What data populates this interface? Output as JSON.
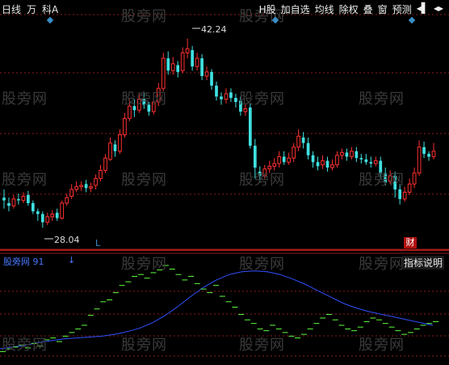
{
  "header": {
    "tabs": [
      {
        "label": "日线"
      },
      {
        "label": "万"
      },
      {
        "label": "科A"
      }
    ]
  },
  "toolbar": {
    "items": [
      {
        "label": "H股"
      },
      {
        "label": "加自选"
      },
      {
        "label": "均线"
      },
      {
        "label": "除权"
      },
      {
        "label": "叠"
      },
      {
        "label": "窗"
      },
      {
        "label": "预测"
      },
      {
        "label": "◂▌"
      },
      {
        "label": "◂▸"
      }
    ]
  },
  "watermark": "股旁网",
  "price_labels": {
    "high": "42.24",
    "low": "28.04"
  },
  "markers": {
    "cai": "财",
    "l_mark": "L",
    "arrow": "↓"
  },
  "indicator": {
    "name": "股旁网  91",
    "explain_button": "指标说明"
  },
  "colors": {
    "background": "#000000",
    "up_candle": "#ff3030",
    "down_candle": "#40e0e0",
    "grid": "#8b1a1a",
    "indicator_line": "#3050ff",
    "indicator_dash": "#60ff40"
  },
  "chart_data": {
    "type": "candlestick",
    "ylim": [
      27,
      44
    ],
    "candles": [
      [
        30.6,
        30.4,
        31.2,
        29.8
      ],
      [
        30.2,
        30.0,
        30.6,
        29.6
      ],
      [
        30.0,
        30.5,
        30.8,
        29.8
      ],
      [
        30.5,
        30.4,
        30.9,
        30.1
      ],
      [
        30.4,
        30.7,
        31.0,
        30.2
      ],
      [
        30.8,
        30.2,
        31.1,
        30.0
      ],
      [
        30.2,
        29.6,
        30.4,
        29.4
      ],
      [
        29.6,
        29.4,
        29.8,
        28.9
      ],
      [
        29.4,
        28.8,
        29.6,
        28.4
      ],
      [
        28.8,
        29.2,
        29.5,
        28.6
      ],
      [
        29.2,
        29.4,
        29.7,
        28.9
      ],
      [
        29.5,
        29.1,
        29.8,
        28.9
      ],
      [
        29.1,
        30.2,
        30.4,
        29.0
      ],
      [
        30.2,
        30.6,
        30.9,
        30.0
      ],
      [
        30.7,
        31.2,
        31.6,
        30.5
      ],
      [
        31.2,
        31.4,
        31.8,
        31.0
      ],
      [
        31.4,
        31.5,
        31.8,
        31.1
      ],
      [
        31.6,
        31.3,
        31.9,
        31.0
      ],
      [
        31.3,
        31.4,
        31.7,
        31.0
      ],
      [
        31.5,
        32.0,
        32.3,
        31.2
      ],
      [
        32.0,
        32.6,
        33.0,
        31.8
      ],
      [
        32.6,
        33.5,
        33.8,
        32.4
      ],
      [
        33.4,
        34.6,
        35.0,
        33.3
      ],
      [
        34.5,
        34.0,
        34.8,
        33.6
      ],
      [
        34.0,
        35.2,
        35.6,
        33.8
      ],
      [
        35.2,
        36.4,
        36.8,
        35.0
      ],
      [
        36.4,
        37.3,
        37.8,
        36.2
      ],
      [
        37.3,
        37.0,
        37.8,
        36.5
      ],
      [
        37.0,
        37.8,
        38.2,
        36.8
      ],
      [
        37.8,
        37.4,
        38.3,
        37.1
      ],
      [
        37.4,
        36.9,
        37.6,
        36.6
      ],
      [
        36.9,
        37.6,
        38.0,
        36.7
      ],
      [
        37.6,
        38.6,
        39.0,
        37.3
      ],
      [
        38.6,
        40.8,
        41.2,
        38.4
      ],
      [
        40.8,
        39.9,
        41.3,
        39.6
      ],
      [
        39.9,
        40.4,
        40.9,
        39.6
      ],
      [
        40.3,
        39.8,
        40.6,
        39.4
      ],
      [
        39.9,
        41.2,
        41.6,
        39.7
      ],
      [
        41.2,
        41.5,
        42.24,
        40.8
      ],
      [
        41.4,
        40.2,
        41.7,
        39.9
      ],
      [
        40.2,
        40.8,
        41.2,
        39.9
      ],
      [
        40.8,
        39.5,
        41.1,
        39.2
      ],
      [
        39.5,
        39.8,
        40.2,
        39.2
      ],
      [
        39.8,
        38.8,
        40.0,
        38.5
      ],
      [
        38.8,
        38.0,
        39.1,
        37.7
      ],
      [
        38.0,
        37.8,
        38.3,
        37.4
      ],
      [
        37.8,
        38.2,
        38.6,
        37.5
      ],
      [
        38.3,
        37.9,
        38.6,
        37.6
      ],
      [
        37.9,
        37.6,
        38.2,
        37.2
      ],
      [
        37.7,
        36.9,
        38.0,
        36.6
      ],
      [
        36.9,
        37.1,
        37.5,
        36.6
      ],
      [
        37.2,
        34.4,
        37.5,
        34.2
      ],
      [
        34.4,
        32.8,
        34.9,
        32.0
      ],
      [
        32.5,
        32.2,
        32.9,
        31.7
      ],
      [
        32.2,
        32.7,
        33.0,
        32.0
      ],
      [
        32.7,
        32.9,
        33.3,
        32.4
      ],
      [
        32.9,
        33.1,
        33.5,
        32.6
      ],
      [
        33.1,
        33.6,
        34.0,
        32.8
      ],
      [
        33.6,
        33.2,
        34.0,
        33.0
      ],
      [
        33.2,
        33.5,
        33.9,
        33.0
      ],
      [
        33.5,
        34.3,
        34.6,
        33.2
      ],
      [
        34.3,
        35.1,
        35.6,
        34.0
      ],
      [
        35.0,
        34.6,
        35.4,
        34.2
      ],
      [
        34.6,
        33.7,
        35.0,
        33.4
      ],
      [
        33.7,
        33.2,
        34.0,
        32.8
      ],
      [
        33.2,
        32.9,
        33.6,
        32.6
      ],
      [
        33.0,
        33.3,
        33.7,
        32.7
      ],
      [
        33.3,
        32.8,
        33.6,
        32.5
      ],
      [
        32.8,
        33.0,
        33.4,
        32.6
      ],
      [
        33.0,
        33.7,
        34.0,
        32.8
      ],
      [
        33.7,
        33.9,
        34.2,
        33.4
      ],
      [
        33.9,
        33.6,
        34.2,
        33.3
      ],
      [
        33.6,
        34.0,
        34.3,
        33.4
      ],
      [
        34.0,
        33.5,
        34.3,
        33.2
      ],
      [
        33.5,
        33.4,
        33.8,
        33.1
      ],
      [
        33.4,
        33.2,
        33.8,
        33.0
      ],
      [
        33.2,
        33.1,
        33.6,
        32.8
      ],
      [
        33.1,
        33.3,
        33.6,
        32.9
      ],
      [
        33.3,
        32.4,
        33.6,
        32.0
      ],
      [
        32.4,
        31.7,
        32.8,
        31.5
      ],
      [
        31.8,
        32.2,
        32.6,
        31.6
      ],
      [
        32.2,
        31.2,
        32.5,
        30.6
      ],
      [
        31.2,
        30.5,
        31.6,
        30.1
      ],
      [
        30.5,
        31.0,
        31.4,
        30.3
      ],
      [
        31.0,
        31.6,
        32.0,
        30.8
      ],
      [
        31.6,
        32.4,
        32.8,
        31.3
      ],
      [
        32.4,
        34.3,
        34.8,
        32.2
      ],
      [
        34.3,
        33.8,
        34.7,
        33.5
      ],
      [
        33.8,
        33.6,
        34.0,
        33.3
      ],
      [
        33.6,
        34.0,
        34.6,
        33.4
      ]
    ]
  },
  "indicator_data": {
    "line": [
      0.08,
      0.1,
      0.12,
      0.15,
      0.17,
      0.19,
      0.2,
      0.21,
      0.22,
      0.24,
      0.27,
      0.31,
      0.37,
      0.45,
      0.55,
      0.66,
      0.76,
      0.84,
      0.9,
      0.93,
      0.94,
      0.93,
      0.9,
      0.85,
      0.79,
      0.72,
      0.65,
      0.58,
      0.53,
      0.49,
      0.46,
      0.43,
      0.4,
      0.37,
      0.34
    ],
    "dashes": [
      0.05,
      0.08,
      0.1,
      0.12,
      0.09,
      0.14,
      0.11,
      0.18,
      0.2,
      0.16,
      0.22,
      0.26,
      0.3,
      0.34,
      0.45,
      0.52,
      0.6,
      0.62,
      0.7,
      0.78,
      0.82,
      0.88,
      0.9,
      0.86,
      0.92,
      0.95,
      1.0,
      0.96,
      0.9,
      0.84,
      0.88,
      0.8,
      0.74,
      0.7,
      0.78,
      0.66,
      0.6,
      0.54,
      0.46,
      0.4,
      0.36,
      0.3,
      0.28,
      0.34,
      0.3,
      0.26,
      0.22,
      0.2,
      0.24,
      0.3,
      0.36,
      0.42,
      0.46,
      0.4,
      0.34,
      0.3,
      0.28,
      0.32,
      0.38,
      0.42,
      0.4,
      0.36,
      0.32,
      0.28,
      0.24,
      0.26,
      0.3,
      0.34,
      0.36,
      0.38
    ]
  }
}
